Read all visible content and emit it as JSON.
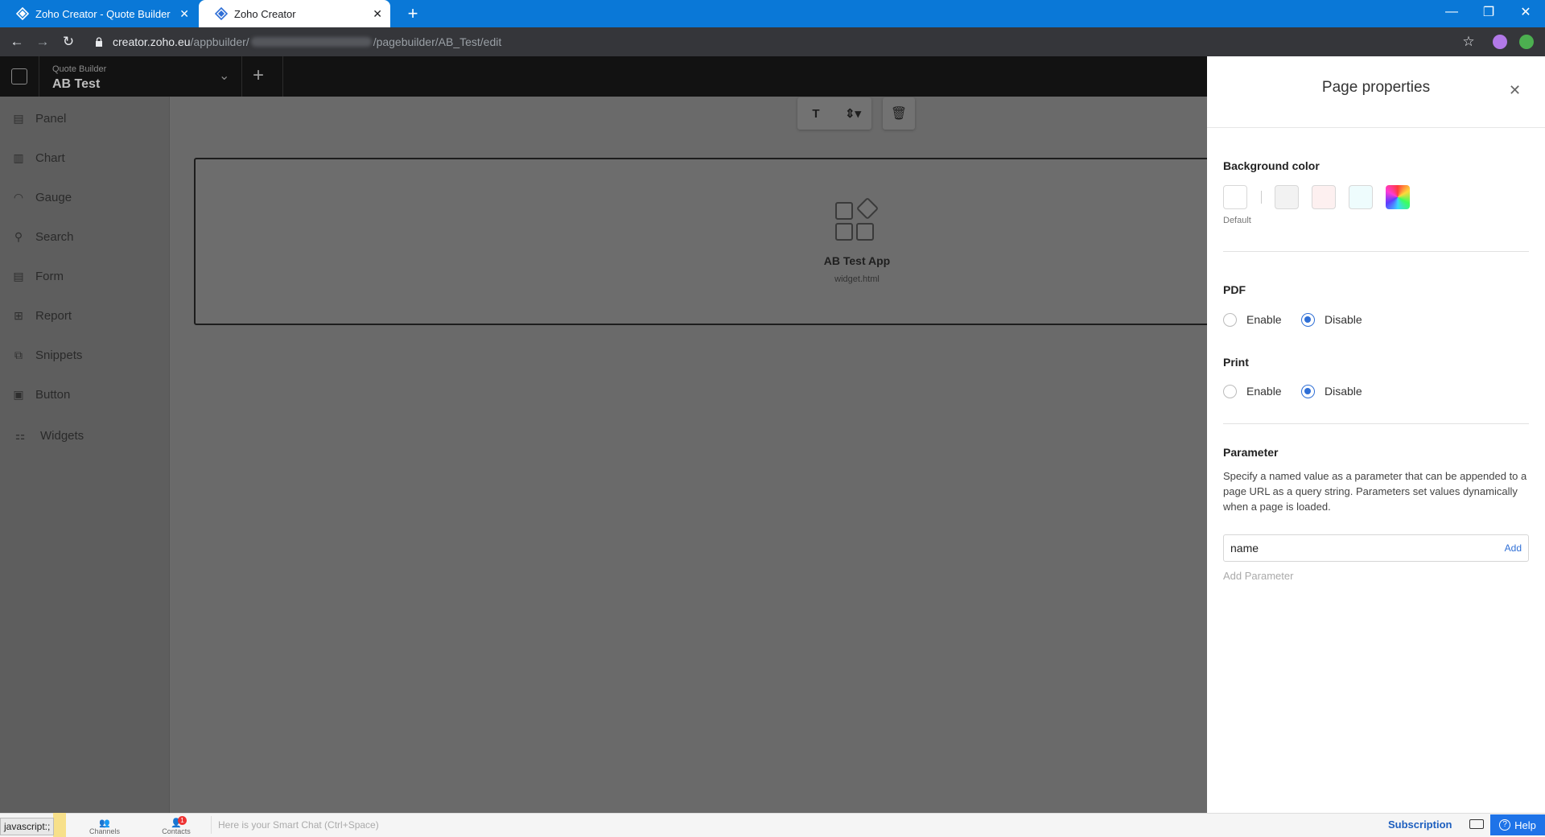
{
  "browser": {
    "tabs": [
      {
        "title": "Zoho Creator - Quote Builder",
        "active": false
      },
      {
        "title": "Zoho Creator",
        "active": true
      }
    ],
    "url_host": "creator.zoho.eu",
    "url_path_start": "/appbuilder/",
    "url_path_end": "/pagebuilder/AB_Test/edit"
  },
  "header": {
    "app_name": "Quote Builder",
    "page_name": "AB Test"
  },
  "sidebar": {
    "items": [
      {
        "label": "Panel",
        "icon": "panel-icon"
      },
      {
        "label": "Chart",
        "icon": "chart-icon"
      },
      {
        "label": "Gauge",
        "icon": "gauge-icon"
      },
      {
        "label": "Search",
        "icon": "search-icon"
      },
      {
        "label": "Form",
        "icon": "form-icon"
      },
      {
        "label": "Report",
        "icon": "report-icon"
      },
      {
        "label": "Snippets",
        "icon": "snippets-icon"
      },
      {
        "label": "Button",
        "icon": "button-icon"
      },
      {
        "label": "Widgets",
        "icon": "widgets-icon"
      }
    ]
  },
  "canvas": {
    "toolbar": {
      "text_btn": "T"
    },
    "widget": {
      "name": "AB Test App",
      "file": "widget.html"
    }
  },
  "panel": {
    "title": "Page properties",
    "background_color": {
      "label": "Background color",
      "default_label": "Default",
      "swatches": [
        "#ffffff",
        "#f2f2f2",
        "#fdf0f0",
        "#eefcfd",
        "rainbow"
      ]
    },
    "pdf": {
      "label": "PDF",
      "enable": "Enable",
      "disable": "Disable",
      "selected": "Disable"
    },
    "print": {
      "label": "Print",
      "enable": "Enable",
      "disable": "Disable",
      "selected": "Disable"
    },
    "parameter": {
      "label": "Parameter",
      "description": "Specify a named value as a parameter that can be appended to a page URL as a query string. Parameters set values dynamically when a page is loaded.",
      "input_value": "name",
      "add_label": "Add",
      "add_parameter_label": "Add Parameter"
    }
  },
  "bottombar": {
    "status_text": "javascript:;",
    "channels": "Channels",
    "contacts": "Contacts",
    "contacts_badge": "1",
    "smartchat_placeholder": "Here is your Smart Chat (Ctrl+Space)",
    "subscription": "Subscription",
    "help": "Help"
  },
  "colors": {
    "browser_blue": "#0a78d7",
    "accent_blue": "#2f6fd6",
    "help_blue": "#1e73e8"
  }
}
